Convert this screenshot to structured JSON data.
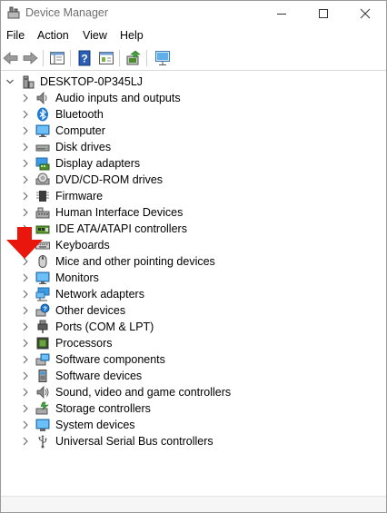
{
  "window": {
    "title": "Device Manager"
  },
  "menu": {
    "file": "File",
    "action": "Action",
    "view": "View",
    "help": "Help"
  },
  "tree": {
    "root": {
      "label": "DESKTOP-0P345LJ",
      "icon": "computer-tower-icon",
      "expanded": true
    },
    "categories": [
      {
        "label": "Audio inputs and outputs",
        "icon": "speaker-icon"
      },
      {
        "label": "Bluetooth",
        "icon": "bluetooth-icon"
      },
      {
        "label": "Computer",
        "icon": "monitor-icon"
      },
      {
        "label": "Disk drives",
        "icon": "disk-drive-icon"
      },
      {
        "label": "Display adapters",
        "icon": "display-adapter-icon"
      },
      {
        "label": "DVD/CD-ROM drives",
        "icon": "dvd-drive-icon"
      },
      {
        "label": "Firmware",
        "icon": "firmware-chip-icon"
      },
      {
        "label": "Human Interface Devices",
        "icon": "hid-icon"
      },
      {
        "label": "IDE ATA/ATAPI controllers",
        "icon": "ide-controller-icon"
      },
      {
        "label": "Keyboards",
        "icon": "keyboard-icon"
      },
      {
        "label": "Mice and other pointing devices",
        "icon": "mouse-icon"
      },
      {
        "label": "Monitors",
        "icon": "monitor-icon"
      },
      {
        "label": "Network adapters",
        "icon": "network-adapter-icon"
      },
      {
        "label": "Other devices",
        "icon": "unknown-device-icon"
      },
      {
        "label": "Ports (COM & LPT)",
        "icon": "port-icon"
      },
      {
        "label": "Processors",
        "icon": "processor-icon"
      },
      {
        "label": "Software components",
        "icon": "software-component-icon"
      },
      {
        "label": "Software devices",
        "icon": "software-device-icon"
      },
      {
        "label": "Sound, video and game controllers",
        "icon": "sound-controller-icon"
      },
      {
        "label": "Storage controllers",
        "icon": "storage-controller-icon"
      },
      {
        "label": "System devices",
        "icon": "system-device-icon"
      },
      {
        "label": "Universal Serial Bus controllers",
        "icon": "usb-icon"
      }
    ]
  },
  "colors": {
    "annotation_arrow": "#e8160c",
    "accent_blue": "#1e7bd8"
  }
}
